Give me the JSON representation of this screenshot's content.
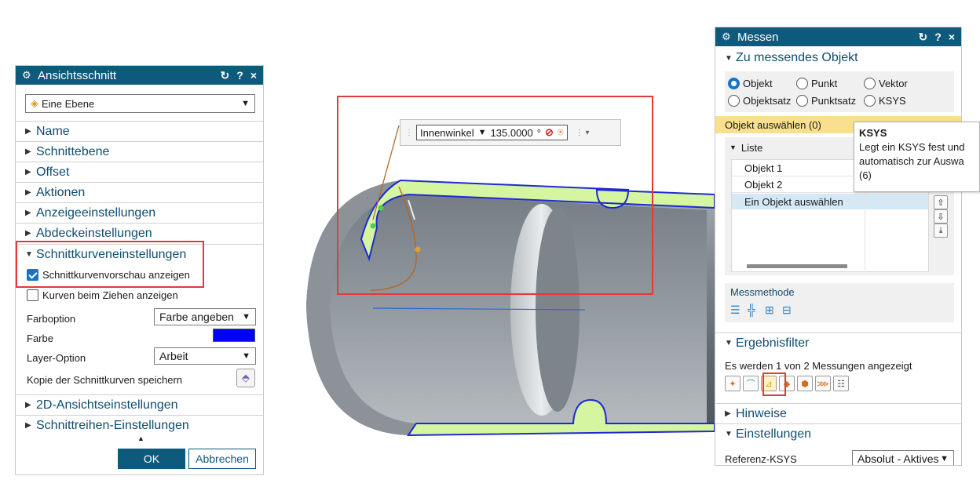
{
  "left_dialog": {
    "title": "Ansichtsschnitt",
    "title_icons": [
      "↻",
      "?",
      "×"
    ],
    "plane_type": "Eine Ebene",
    "sections": [
      "Name",
      "Schnittebene",
      "Offset",
      "Aktionen",
      "Anzeigeeinstellungen",
      "Abdeckeinstellungen"
    ],
    "expanded_section": "Schnittkurveneinstellungen",
    "preview_checkbox_label": "Schnittkurvenvorschau anzeigen",
    "drag_checkbox_label": "Kurven beim Ziehen anzeigen",
    "color_option_label": "Farboption",
    "color_option_value": "Farbe angeben",
    "color_label": "Farbe",
    "color_value": "#0000ff",
    "layer_option_label": "Layer-Option",
    "layer_option_value": "Arbeit",
    "save_copy_label": "Kopie der Schnittkurven speichern",
    "lower_sections": [
      "2D-Ansichtseinstellungen",
      "Schnittreihen-Einstellungen"
    ],
    "ok_label": "OK",
    "cancel_label": "Abbrechen"
  },
  "viewport": {
    "angle_label": "Innenwinkel",
    "angle_value": "135.0000",
    "angle_unit": "°"
  },
  "right_dialog": {
    "title": "Messen",
    "title_icons": [
      "↻",
      "?",
      "×"
    ],
    "section_object": "Zu messendes Objekt",
    "radio_options": [
      "Objekt",
      "Punkt",
      "Vektor",
      "Objektsatz",
      "Punktsatz",
      "KSYS"
    ],
    "selected_radio": "Objekt",
    "select_object_label": "Objekt auswählen (0)",
    "list_label": "Liste",
    "list_items": [
      "Objekt 1",
      "Objekt 2",
      "Ein Objekt auswählen"
    ],
    "method_label": "Messmethode",
    "section_filter": "Ergebnisfilter",
    "filter_status": "Es werden 1 von 2 Messungen angezeigt",
    "section_hints": "Hinweise",
    "section_settings": "Einstellungen",
    "ref_ksys_label": "Referenz-KSYS",
    "ref_ksys_value": "Absolut - Aktives"
  },
  "tooltip": {
    "title": "KSYS",
    "line1": "Legt ein KSYS fest und",
    "line2": "automatisch zur Auswa",
    "line3": "(6)"
  },
  "colors": {
    "accent": "#0e5a7c",
    "highlight": "#f8e08e",
    "selection": "#d4e8f6",
    "annotation_red": "#e23a3a",
    "section_face": "#d6f5a0"
  }
}
